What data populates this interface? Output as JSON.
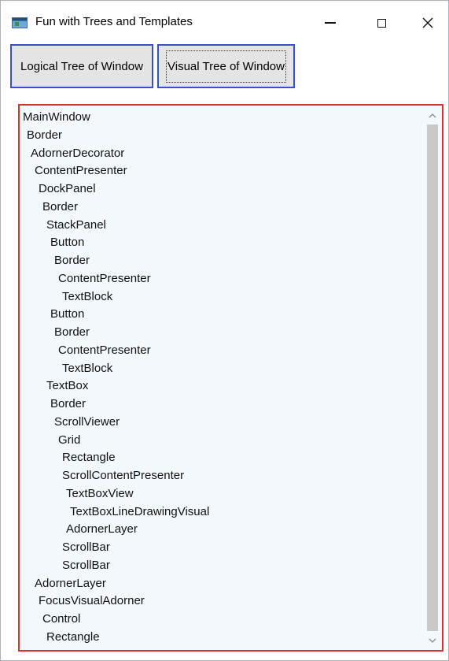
{
  "window": {
    "title": "Fun with Trees and Templates",
    "app_icon": "window-app-icon",
    "controls": {
      "minimize_icon": "minimize-icon",
      "maximize_icon": "maximize-icon",
      "close_symbol": "✕"
    }
  },
  "toolbar": {
    "logical_tree_label": "Logical Tree of Window",
    "visual_tree_label": "Visual Tree of Window"
  },
  "tree_output": {
    "items": [
      {
        "text": "MainWindow",
        "depth": 0
      },
      {
        "text": "Border",
        "depth": 1
      },
      {
        "text": "AdornerDecorator",
        "depth": 2
      },
      {
        "text": "ContentPresenter",
        "depth": 3
      },
      {
        "text": "DockPanel",
        "depth": 4
      },
      {
        "text": "Border",
        "depth": 5
      },
      {
        "text": "StackPanel",
        "depth": 6
      },
      {
        "text": "Button",
        "depth": 7
      },
      {
        "text": "Border",
        "depth": 8
      },
      {
        "text": "ContentPresenter",
        "depth": 9
      },
      {
        "text": "TextBlock",
        "depth": 10
      },
      {
        "text": "Button",
        "depth": 7
      },
      {
        "text": "Border",
        "depth": 8
      },
      {
        "text": "ContentPresenter",
        "depth": 9
      },
      {
        "text": "TextBlock",
        "depth": 10
      },
      {
        "text": "TextBox",
        "depth": 6
      },
      {
        "text": "Border",
        "depth": 7
      },
      {
        "text": "ScrollViewer",
        "depth": 8
      },
      {
        "text": "Grid",
        "depth": 9
      },
      {
        "text": "Rectangle",
        "depth": 10
      },
      {
        "text": "ScrollContentPresenter",
        "depth": 10
      },
      {
        "text": "TextBoxView",
        "depth": 11
      },
      {
        "text": "TextBoxLineDrawingVisual",
        "depth": 12
      },
      {
        "text": "AdornerLayer",
        "depth": 11
      },
      {
        "text": "ScrollBar",
        "depth": 10
      },
      {
        "text": "ScrollBar",
        "depth": 10
      },
      {
        "text": "AdornerLayer",
        "depth": 3
      },
      {
        "text": "FocusVisualAdorner",
        "depth": 4
      },
      {
        "text": "Control",
        "depth": 5
      },
      {
        "text": "Rectangle",
        "depth": 6
      }
    ],
    "scrollbar": {
      "up_arrow": "˄",
      "down_arrow": "˅"
    }
  }
}
